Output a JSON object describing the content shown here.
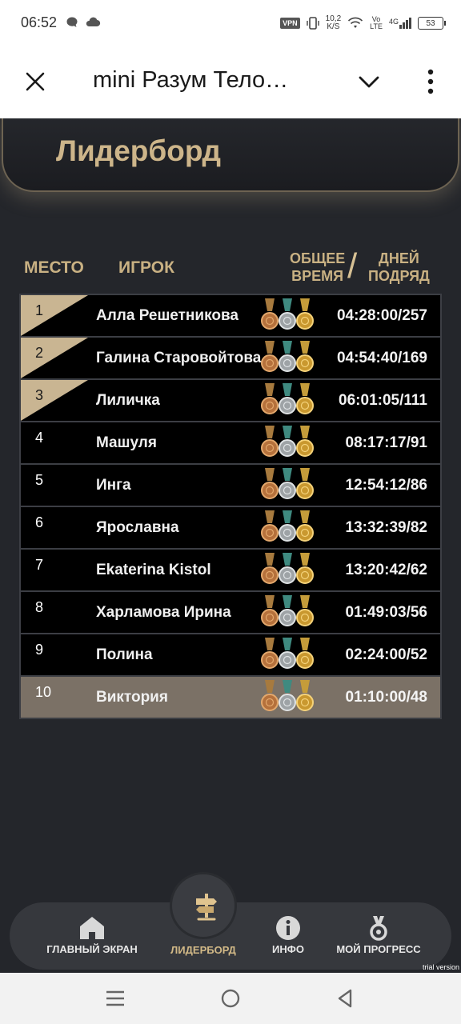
{
  "status_bar": {
    "time": "06:52",
    "vpn": "VPN",
    "speed_value": "10,2",
    "speed_unit": "K/S",
    "volte_top": "Vo",
    "volte_bottom": "LTE",
    "network": "4G",
    "battery": "53"
  },
  "header": {
    "title": "mini Разум Тело…"
  },
  "leaderboard": {
    "title": "Лидерборд",
    "columns": {
      "place": "МЕСТО",
      "player": "ИГРОК",
      "time_line1": "ОБЩЕЕ",
      "time_line2": "ВРЕМЯ",
      "days_line1": "ДНЕЙ",
      "days_line2": "ПОДРЯД"
    },
    "rows": [
      {
        "place": "1",
        "name": "Алла Решетникова",
        "score": "04:28:00/257"
      },
      {
        "place": "2",
        "name": "Галина Старовойтова",
        "score": "04:54:40/169"
      },
      {
        "place": "3",
        "name": "Лиличка",
        "score": "06:01:05/111"
      },
      {
        "place": "4",
        "name": "Машуля",
        "score": "08:17:17/91"
      },
      {
        "place": "5",
        "name": "Инга",
        "score": "12:54:12/86"
      },
      {
        "place": "6",
        "name": "Ярославна",
        "score": "13:32:39/82"
      },
      {
        "place": "7",
        "name": "Ekaterina Kistol",
        "score": "13:20:42/62"
      },
      {
        "place": "8",
        "name": "Харламова Ирина",
        "score": "01:49:03/56"
      },
      {
        "place": "9",
        "name": "Полина",
        "score": "02:24:00/52"
      },
      {
        "place": "10",
        "name": "Виктория",
        "score": "01:10:00/48"
      }
    ]
  },
  "nav": {
    "home": "ГЛАВНЫЙ ЭКРАН",
    "leaderboard": "ЛИДЕРБОРД",
    "info": "ИНФО",
    "progress": "МОЙ ПРОГРЕСС"
  },
  "watermark": "trial version",
  "colors": {
    "background": "#24262b",
    "accent_gold": "#cdb58a",
    "highlight_row": "#7b7166",
    "row_bg": "#000000"
  }
}
